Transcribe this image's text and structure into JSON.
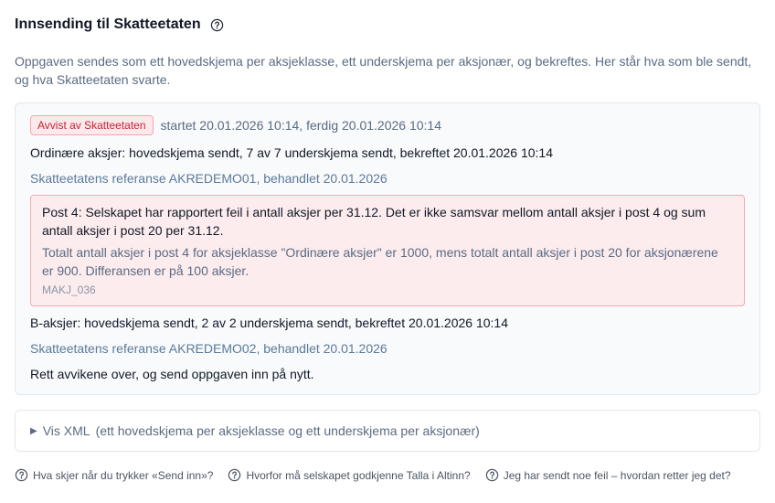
{
  "header": {
    "title": "Innsending til Skatteetaten",
    "help_icon": "question-circle-icon"
  },
  "intro": "Oppgaven sendes som ett hovedskjema per aksjeklasse, ett underskjema per aksjonær, og bekreftes. Her står hva som ble sendt, og hva Skatteetaten svarte.",
  "submission": {
    "status_badge": "Avvist av Skatteetaten",
    "status_color": "#c0263a",
    "meta": "startet 20.01.2026 10:14, ferdig 20.01.2026 10:14",
    "ordinary": {
      "line": "Ordinære aksjer: hovedskjema sendt, 7 av 7 underskjema sendt, bekreftet 20.01.2026 10:14",
      "reference": "Skatteetatens referanse AKREDEMO01, behandlet 20.01.2026"
    },
    "error": {
      "title": "Post 4: Selskapet har rapportert feil i antall aksjer per 31.12. Det er ikke samsvar mellom antall aksjer i post 4 og sum antall aksjer i post 20 per 31.12.",
      "description": "Totalt antall aksjer i post 4 for aksjeklasse \"Ordinære aksjer\" er 1000, mens totalt antall aksjer i post 20 for aksjonærene er 900. Differansen er på 100 aksjer.",
      "code": "MAKJ_036"
    },
    "b_shares": {
      "line": "B-aksjer: hovedskjema sendt, 2 av 2 underskjema sendt, bekreftet 20.01.2026 10:14",
      "reference": "Skatteetatens referanse AKREDEMO02, behandlet 20.01.2026"
    },
    "instruction": "Rett avvikene over, og send oppgaven inn på nytt."
  },
  "xml_toggle": {
    "label": "Vis XML",
    "hint": "(ett hovedskjema per aksjeklasse og ett underskjema per aksjonær)",
    "icon": "caret-right-icon"
  },
  "faq": [
    {
      "label": "Hva skjer når du trykker «Send inn»?",
      "icon": "question-circle-icon"
    },
    {
      "label": "Hvorfor må selskapet godkjenne Talla i Altinn?",
      "icon": "question-circle-icon"
    },
    {
      "label": "Jeg har sendt noe feil – hvordan retter jeg det?",
      "icon": "question-circle-icon"
    }
  ]
}
